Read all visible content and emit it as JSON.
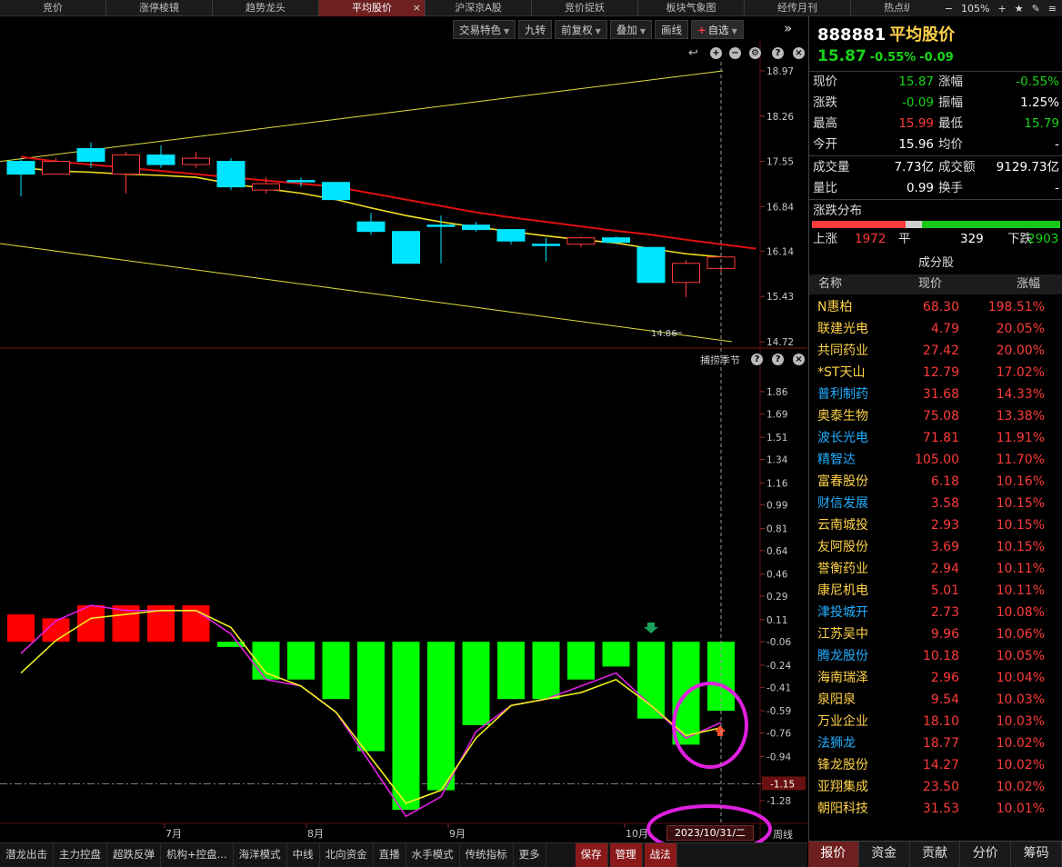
{
  "top_tabs": [
    {
      "label": "竞价",
      "active": false
    },
    {
      "label": "涨停棱镜",
      "active": false
    },
    {
      "label": "趋势龙头",
      "active": false
    },
    {
      "label": "平均股价",
      "active": true
    },
    {
      "label": "沪深京A股",
      "active": false
    },
    {
      "label": "竞价捉妖",
      "active": false
    },
    {
      "label": "板块气象图",
      "active": false
    },
    {
      "label": "经传月刊",
      "active": false
    },
    {
      "label": "热点纵览",
      "active": false
    }
  ],
  "zoom": "105%",
  "toolbar": {
    "jiaoyi": "交易特色",
    "jiuzhuan": "九转",
    "fuquan": "前复权",
    "diejia": "叠加",
    "huaxian": "画线",
    "zixuan": "自选"
  },
  "main_chart": {
    "price_ticks": [
      "18.97",
      "18.26",
      "17.55",
      "16.84",
      "16.14",
      "15.43",
      "14.72"
    ],
    "low_label": "14.86"
  },
  "sub_chart": {
    "title": "捕捞季节",
    "ticks": [
      "1.86",
      "1.69",
      "1.51",
      "1.34",
      "1.16",
      "0.99",
      "0.81",
      "0.64",
      "0.46",
      "0.29",
      "0.11",
      "-0.06",
      "-0.24",
      "-0.41",
      "-0.59",
      "-0.76",
      "-0.94",
      "-1.15",
      "-1.28"
    ],
    "current_value": "-1.15"
  },
  "months": [
    "7月",
    "8月",
    "9月",
    "10月"
  ],
  "date_label": "2023/10/31/二",
  "zhouxian": "周线",
  "bottom_tabs": [
    "潜龙出击",
    "主力控盘",
    "超跌反弹",
    "机构+控盘...",
    "海洋模式",
    "中线",
    "北向资金",
    "直播",
    "水手模式",
    "传统指标",
    "更多"
  ],
  "bottom_buttons": [
    "保存",
    "管理",
    "战法"
  ],
  "quote": {
    "code": "888881",
    "name": "平均股价",
    "price": "15.87",
    "change_pct": "-0.55%",
    "change": "-0.09",
    "rows": [
      {
        "l1": "现价",
        "v1": "15.87",
        "c1": "green",
        "l2": "涨幅",
        "v2": "-0.55%",
        "c2": "green"
      },
      {
        "l1": "涨跌",
        "v1": "-0.09",
        "c1": "green",
        "l2": "振幅",
        "v2": "1.25%",
        "c2": "white"
      },
      {
        "l1": "最高",
        "v1": "15.99",
        "c1": "red",
        "l2": "最低",
        "v2": "15.79",
        "c2": "green"
      },
      {
        "l1": "今开",
        "v1": "15.96",
        "c1": "white",
        "l2": "均价",
        "v2": "-",
        "c2": "white"
      }
    ],
    "rows2": [
      {
        "l1": "成交量",
        "v1": "7.73亿",
        "c1": "white",
        "l2": "成交额",
        "v2": "9129.73亿",
        "c2": "white"
      },
      {
        "l1": "量比",
        "v1": "0.99",
        "c1": "white",
        "l2": "换手",
        "v2": "-",
        "c2": "white"
      }
    ],
    "dist_title": "涨跌分布",
    "up_label": "上涨",
    "up": "1972",
    "flat_label": "平",
    "flat": "329",
    "down_label": "下跌",
    "down": "2903"
  },
  "components": {
    "title": "成分股",
    "headers": {
      "name": "名称",
      "price": "现价",
      "pct": "涨幅"
    },
    "rows": [
      {
        "name": "N惠柏",
        "price": "68.30",
        "pct": "198.51%",
        "nc": "yellow"
      },
      {
        "name": "联建光电",
        "price": "4.79",
        "pct": "20.05%",
        "nc": "yellow"
      },
      {
        "name": "共同药业",
        "price": "27.42",
        "pct": "20.00%",
        "nc": "yellow"
      },
      {
        "name": "*ST天山",
        "price": "12.79",
        "pct": "17.02%",
        "nc": "yellow"
      },
      {
        "name": "普利制药",
        "price": "31.68",
        "pct": "14.33%",
        "nc": "cyan"
      },
      {
        "name": "奥泰生物",
        "price": "75.08",
        "pct": "13.38%",
        "nc": "yellow"
      },
      {
        "name": "波长光电",
        "price": "71.81",
        "pct": "11.91%",
        "nc": "cyan"
      },
      {
        "name": "精智达",
        "price": "105.00",
        "pct": "11.70%",
        "nc": "cyan"
      },
      {
        "name": "富春股份",
        "price": "6.18",
        "pct": "10.16%",
        "nc": "yellow"
      },
      {
        "name": "财信发展",
        "price": "3.58",
        "pct": "10.15%",
        "nc": "cyan"
      },
      {
        "name": "云南城投",
        "price": "2.93",
        "pct": "10.15%",
        "nc": "yellow"
      },
      {
        "name": "友阿股份",
        "price": "3.69",
        "pct": "10.15%",
        "nc": "yellow"
      },
      {
        "name": "誉衡药业",
        "price": "2.94",
        "pct": "10.11%",
        "nc": "yellow"
      },
      {
        "name": "康尼机电",
        "price": "5.01",
        "pct": "10.11%",
        "nc": "yellow"
      },
      {
        "name": "津投城开",
        "price": "2.73",
        "pct": "10.08%",
        "nc": "cyan"
      },
      {
        "name": "江苏吴中",
        "price": "9.96",
        "pct": "10.06%",
        "nc": "yellow"
      },
      {
        "name": "腾龙股份",
        "price": "10.18",
        "pct": "10.05%",
        "nc": "cyan"
      },
      {
        "name": "海南瑞泽",
        "price": "2.96",
        "pct": "10.04%",
        "nc": "yellow"
      },
      {
        "name": "泉阳泉",
        "price": "9.54",
        "pct": "10.03%",
        "nc": "yellow"
      },
      {
        "name": "万业企业",
        "price": "18.10",
        "pct": "10.03%",
        "nc": "yellow"
      },
      {
        "name": "法狮龙",
        "price": "18.77",
        "pct": "10.02%",
        "nc": "cyan"
      },
      {
        "name": "锋龙股份",
        "price": "14.27",
        "pct": "10.02%",
        "nc": "yellow"
      },
      {
        "name": "亚翔集成",
        "price": "23.50",
        "pct": "10.02%",
        "nc": "yellow"
      },
      {
        "name": "朝阳科技",
        "price": "31.53",
        "pct": "10.01%",
        "nc": "yellow"
      }
    ]
  },
  "right_tabs": [
    "报价",
    "资金",
    "贡献",
    "分价",
    "筹码"
  ],
  "candles": [
    {
      "o": 17.55,
      "c": 17.35,
      "h": 17.6,
      "l": 17.0
    },
    {
      "o": 17.35,
      "c": 17.55,
      "h": 17.6,
      "l": 17.35
    },
    {
      "o": 17.75,
      "c": 17.55,
      "h": 17.85,
      "l": 17.45
    },
    {
      "o": 17.35,
      "c": 17.65,
      "h": 17.7,
      "l": 17.05
    },
    {
      "o": 17.65,
      "c": 17.5,
      "h": 17.8,
      "l": 17.45
    },
    {
      "o": 17.5,
      "c": 17.6,
      "h": 17.7,
      "l": 17.45
    },
    {
      "o": 17.55,
      "c": 17.15,
      "h": 17.6,
      "l": 17.1
    },
    {
      "o": 17.1,
      "c": 17.2,
      "h": 17.3,
      "l": 17.05
    },
    {
      "o": 17.25,
      "c": 17.25,
      "h": 17.3,
      "l": 17.15
    },
    {
      "o": 17.22,
      "c": 16.95,
      "h": 17.22,
      "l": 16.95
    },
    {
      "o": 16.6,
      "c": 16.45,
      "h": 16.74,
      "l": 16.4
    },
    {
      "o": 16.45,
      "c": 15.95,
      "h": 16.45,
      "l": 15.95
    },
    {
      "o": 16.55,
      "c": 16.55,
      "h": 16.7,
      "l": 15.95
    },
    {
      "o": 16.55,
      "c": 16.48,
      "h": 16.6,
      "l": 16.45
    },
    {
      "o": 16.48,
      "c": 16.3,
      "h": 16.48,
      "l": 16.25
    },
    {
      "o": 16.25,
      "c": 16.25,
      "h": 16.35,
      "l": 15.98
    },
    {
      "o": 16.25,
      "c": 16.35,
      "h": 16.37,
      "l": 16.2
    },
    {
      "o": 16.35,
      "c": 16.28,
      "h": 16.37,
      "l": 16.25
    },
    {
      "o": 16.2,
      "c": 15.65,
      "h": 16.2,
      "l": 15.65
    },
    {
      "o": 15.65,
      "c": 15.95,
      "h": 16.0,
      "l": 15.42
    },
    {
      "o": 15.87,
      "c": 16.05,
      "h": 16.05,
      "l": 15.8
    }
  ],
  "ma_red": [
    17.55,
    17.5,
    17.45,
    17.4,
    17.35,
    17.3,
    17.25,
    17.2,
    17.15,
    17.05,
    16.95,
    16.85,
    16.75,
    16.67,
    16.6,
    16.53,
    16.46,
    16.4,
    16.32,
    16.25,
    16.18
  ],
  "ma_yellow": [
    17.45,
    17.4,
    17.38,
    17.35,
    17.33,
    17.3,
    17.2,
    17.12,
    17.05,
    16.95,
    16.82,
    16.7,
    16.6,
    16.52,
    16.45,
    16.38,
    16.32,
    16.27,
    16.18,
    16.1,
    16.05
  ],
  "bars": [
    0.15,
    0.12,
    0.22,
    0.22,
    0.22,
    0.22,
    -0.1,
    -0.35,
    -0.35,
    -0.5,
    -0.9,
    -1.35,
    -1.2,
    -0.7,
    -0.5,
    -0.5,
    -0.35,
    -0.25,
    -0.65,
    -0.85,
    -0.59
  ],
  "line_magenta": [
    -0.15,
    0.1,
    0.22,
    0.18,
    0.18,
    0.18,
    0.0,
    -0.35,
    -0.4,
    -0.6,
    -1.0,
    -1.4,
    -1.25,
    -0.75,
    -0.55,
    -0.5,
    -0.4,
    -0.3,
    -0.55,
    -0.8,
    -0.68
  ],
  "line_yellow": [
    -0.3,
    -0.05,
    0.12,
    0.15,
    0.18,
    0.18,
    0.05,
    -0.3,
    -0.4,
    -0.6,
    -0.95,
    -1.3,
    -1.2,
    -0.8,
    -0.55,
    -0.5,
    -0.45,
    -0.35,
    -0.55,
    -0.78,
    -0.72
  ]
}
